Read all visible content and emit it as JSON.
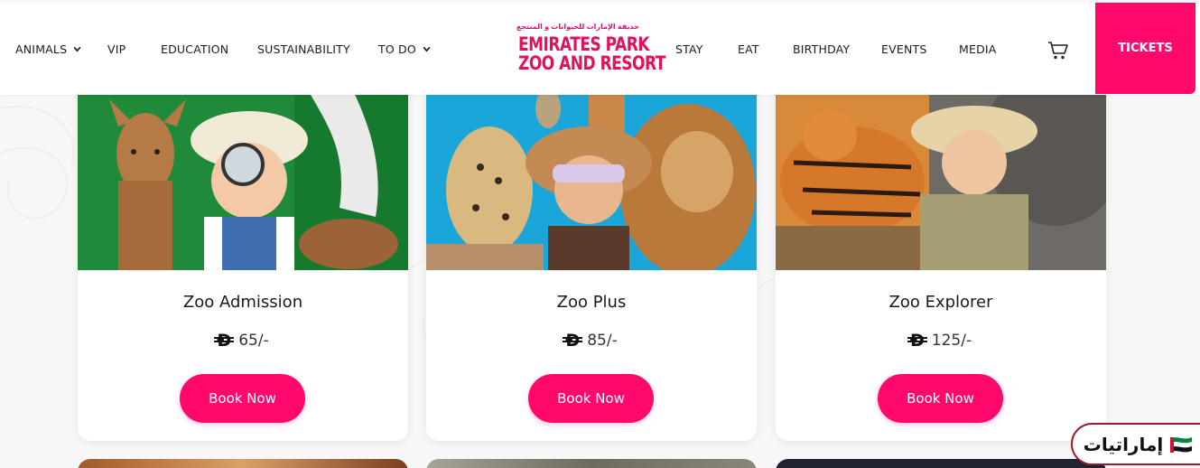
{
  "nav": {
    "left": [
      {
        "label": "ANIMALS",
        "dropdown": true
      },
      {
        "label": "VIP",
        "dropdown": false
      },
      {
        "label": "EDUCATION",
        "dropdown": false
      },
      {
        "label": "SUSTAINABILITY",
        "dropdown": false
      },
      {
        "label": "TO DO",
        "dropdown": true
      }
    ],
    "right": [
      "STAY",
      "EAT",
      "BIRTHDAY",
      "EVENTS",
      "MEDIA"
    ],
    "tickets": "TICKETS"
  },
  "logo": {
    "arabic": "حديقة الإمارات للحيوانات و المنتجع",
    "line1": "EMIRATES PARK",
    "line2": "ZOO AND RESORT"
  },
  "cards": [
    {
      "title": "Zoo Admission",
      "currency": "Đ",
      "price": "65/-",
      "button": "Book Now"
    },
    {
      "title": "Zoo Plus",
      "currency": "Đ",
      "price": "85/-",
      "button": "Book Now"
    },
    {
      "title": "Zoo Explorer",
      "currency": "Đ",
      "price": "125/-",
      "button": "Book Now"
    }
  ],
  "badge": {
    "text": "إماراتيات"
  },
  "colors": {
    "accent": "#ff0a6c",
    "badge_border": "#9c1a2c"
  }
}
